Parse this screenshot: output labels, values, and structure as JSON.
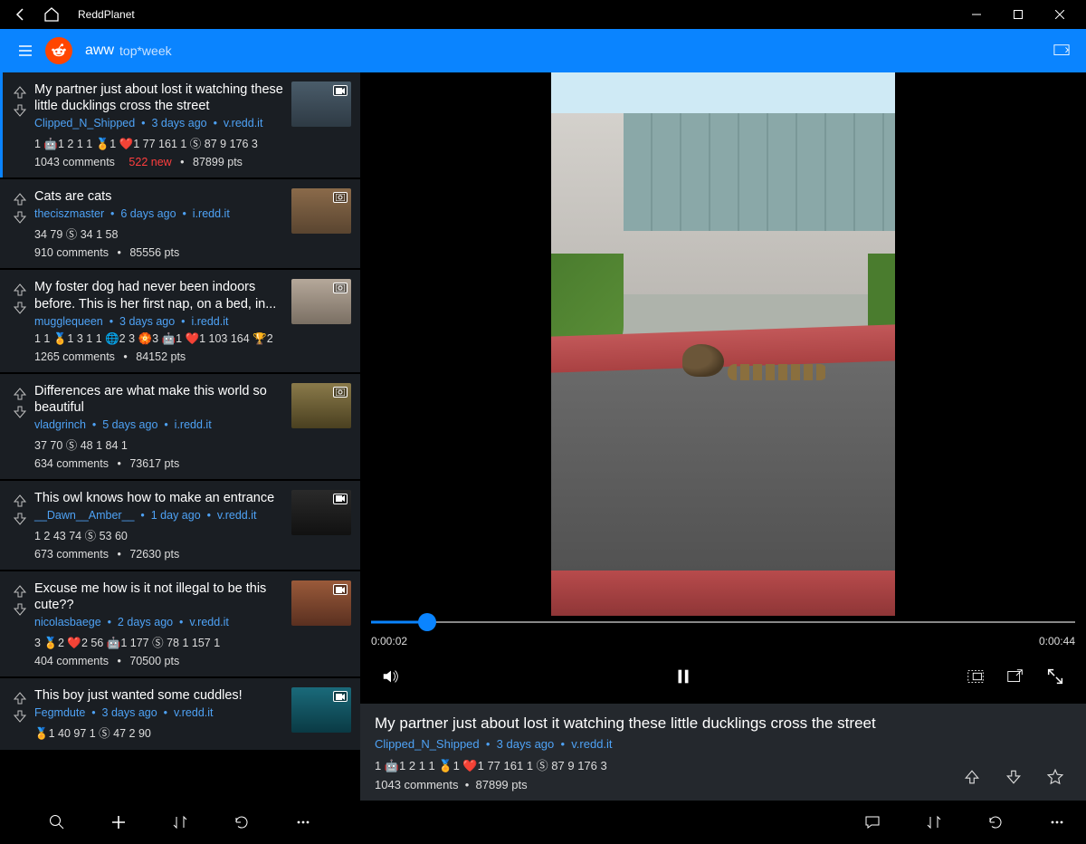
{
  "window": {
    "title": "ReddPlanet"
  },
  "header": {
    "subreddit": "aww",
    "sort": "top*week"
  },
  "posts": [
    {
      "title": "My partner just about lost it watching these little ducklings cross the street",
      "author": "Clipped_N_Shipped",
      "age": "3 days ago",
      "domain": "v.redd.it",
      "awards": "1  🤖1   2   1   1  🏅1  ❤️1   77   161   1  Ⓢ 87   9   176   3",
      "comments": "1043 comments",
      "new": "522 new",
      "points": "87899 pts",
      "selected": true,
      "media": "video"
    },
    {
      "title": "Cats are cats",
      "author": "theciszmaster",
      "age": "6 days ago",
      "domain": "i.redd.it",
      "awards": "34   79   Ⓢ 34   1   58",
      "comments": "910 comments",
      "new": "",
      "points": "85556 pts",
      "selected": false,
      "media": "photo"
    },
    {
      "title": "My foster dog had never been indoors before. This is her first nap, on a bed, in...",
      "author": "mugglequeen",
      "age": "3 days ago",
      "domain": "i.redd.it",
      "awards": "1   1  🏅1   3   1   1  🌐2   3  🏵️3  🤖1  ❤️1   103   164  🏆2",
      "comments": "1265 comments",
      "new": "",
      "points": "84152 pts",
      "selected": false,
      "media": "photo"
    },
    {
      "title": "Differences are what make this world so beautiful",
      "author": "vladgrinch",
      "age": "5 days ago",
      "domain": "i.redd.it",
      "awards": "37   70   Ⓢ 48   1   84   1",
      "comments": "634 comments",
      "new": "",
      "points": "73617 pts",
      "selected": false,
      "media": "photo"
    },
    {
      "title": "This owl knows how to make an entrance",
      "author": "__Dawn__Amber__",
      "age": "1 day ago",
      "domain": "v.redd.it",
      "awards": "1   2   43   74   Ⓢ 53   60",
      "comments": "673 comments",
      "new": "",
      "points": "72630 pts",
      "selected": false,
      "media": "video"
    },
    {
      "title": "Excuse me how is it not illegal to be this cute??",
      "author": "nicolasbaege",
      "age": "2 days ago",
      "domain": "v.redd.it",
      "awards": "3  🏅2  ❤️2   56  🤖1   177   Ⓢ 78   1   157   1",
      "comments": "404 comments",
      "new": "",
      "points": "70500 pts",
      "selected": false,
      "media": "video"
    },
    {
      "title": "This boy just wanted some cuddles!",
      "author": "Fegmdute",
      "age": "3 days ago",
      "domain": "v.redd.it",
      "awards": "🏅1   40   97   1   Ⓢ 47   2   90",
      "comments": "",
      "new": "",
      "points": "",
      "selected": false,
      "media": "video"
    }
  ],
  "player": {
    "current": "0:00:02",
    "duration": "0:00:44"
  },
  "detail": {
    "title": "My partner just about lost it watching these little ducklings cross the street",
    "author": "Clipped_N_Shipped",
    "age": "3 days ago",
    "domain": "v.redd.it",
    "awards": "1  🤖1   2   1   1  🏅1  ❤️1   77   161   1  Ⓢ 87   9   176   3",
    "comments": "1043 comments",
    "points": "87899 pts"
  }
}
